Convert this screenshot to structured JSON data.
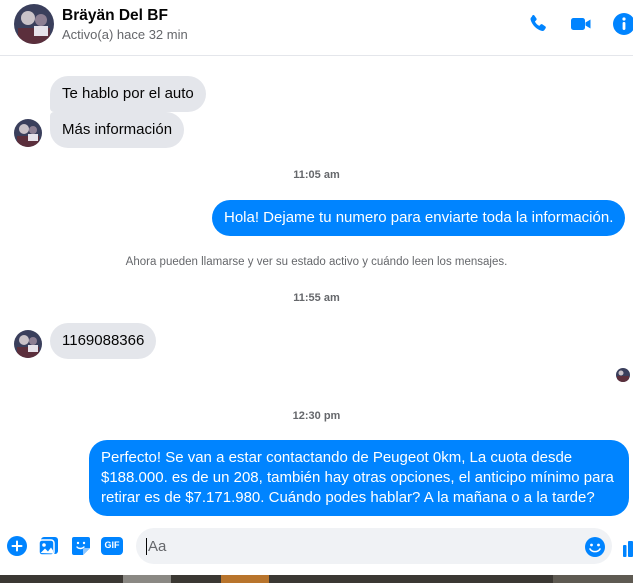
{
  "header": {
    "name": "Bräyän Del BF",
    "status": "Activo(a) hace 32 min",
    "icons": [
      "phone-icon",
      "video-camera-icon",
      "info-icon"
    ],
    "accent_color": "#0084ff"
  },
  "messages": [
    {
      "type": "incoming",
      "text": "Te hablo por el auto"
    },
    {
      "type": "incoming",
      "text": "Más información"
    },
    {
      "type": "timestamp",
      "text": "11:05 am"
    },
    {
      "type": "outgoing",
      "text": "Hola! Dejame tu numero  para enviarte toda la información."
    },
    {
      "type": "system",
      "text": "Ahora pueden llamarse y ver su estado activo y cuándo leen los mensajes."
    },
    {
      "type": "timestamp",
      "text": "11:55 am"
    },
    {
      "type": "incoming",
      "text": "1169088366"
    },
    {
      "type": "timestamp",
      "text": "12:30 pm"
    },
    {
      "type": "outgoing",
      "text": "Perfecto!  Se van a estar contactando de Peugeot 0km, La cuota desde $188.000. es de un 208, también hay otras opciones, el anticipo mínimo para retirar es de $7.171.980. Cuándo podes hablar? A la mañana o a la tarde?"
    }
  ],
  "composer": {
    "placeholder": "Aa",
    "tools": [
      "plus-circle-icon",
      "image-icon",
      "sticker-icon",
      "gif-icon"
    ],
    "gif_label": "GIF"
  }
}
